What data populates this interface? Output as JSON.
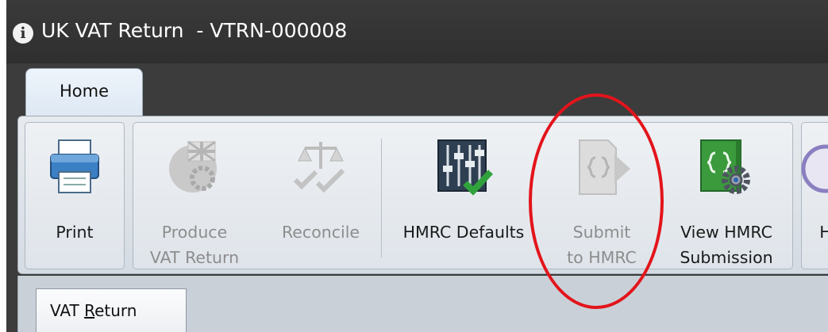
{
  "window": {
    "title": "UK VAT Return  - VTRN-000008",
    "info_icon": "info-circle-icon"
  },
  "ribbon": {
    "tabs": [
      {
        "label": "Home"
      }
    ],
    "buttons": [
      {
        "label": "Print",
        "icon": "printer-icon",
        "enabled": true
      },
      {
        "label": "Produce\nVAT Return",
        "icon": "gear-uk-flag-icon",
        "enabled": false
      },
      {
        "label": "Reconcile",
        "icon": "scales-checkmarks-icon",
        "enabled": false
      },
      {
        "label": "HMRC Defaults",
        "icon": "sliders-check-icon",
        "enabled": true
      },
      {
        "label": "Submit\nto HMRC",
        "icon": "submit-document-icon",
        "enabled": false
      },
      {
        "label": "View HMRC\nSubmission",
        "icon": "document-gear-icon",
        "enabled": true
      },
      {
        "label": "H",
        "icon": "partial-circle-icon",
        "enabled": true
      }
    ]
  },
  "document_tabs": [
    {
      "prefix": "VAT ",
      "underlined": "R",
      "suffix": "eturn"
    }
  ],
  "annotation": {
    "color": "#e3141b"
  }
}
